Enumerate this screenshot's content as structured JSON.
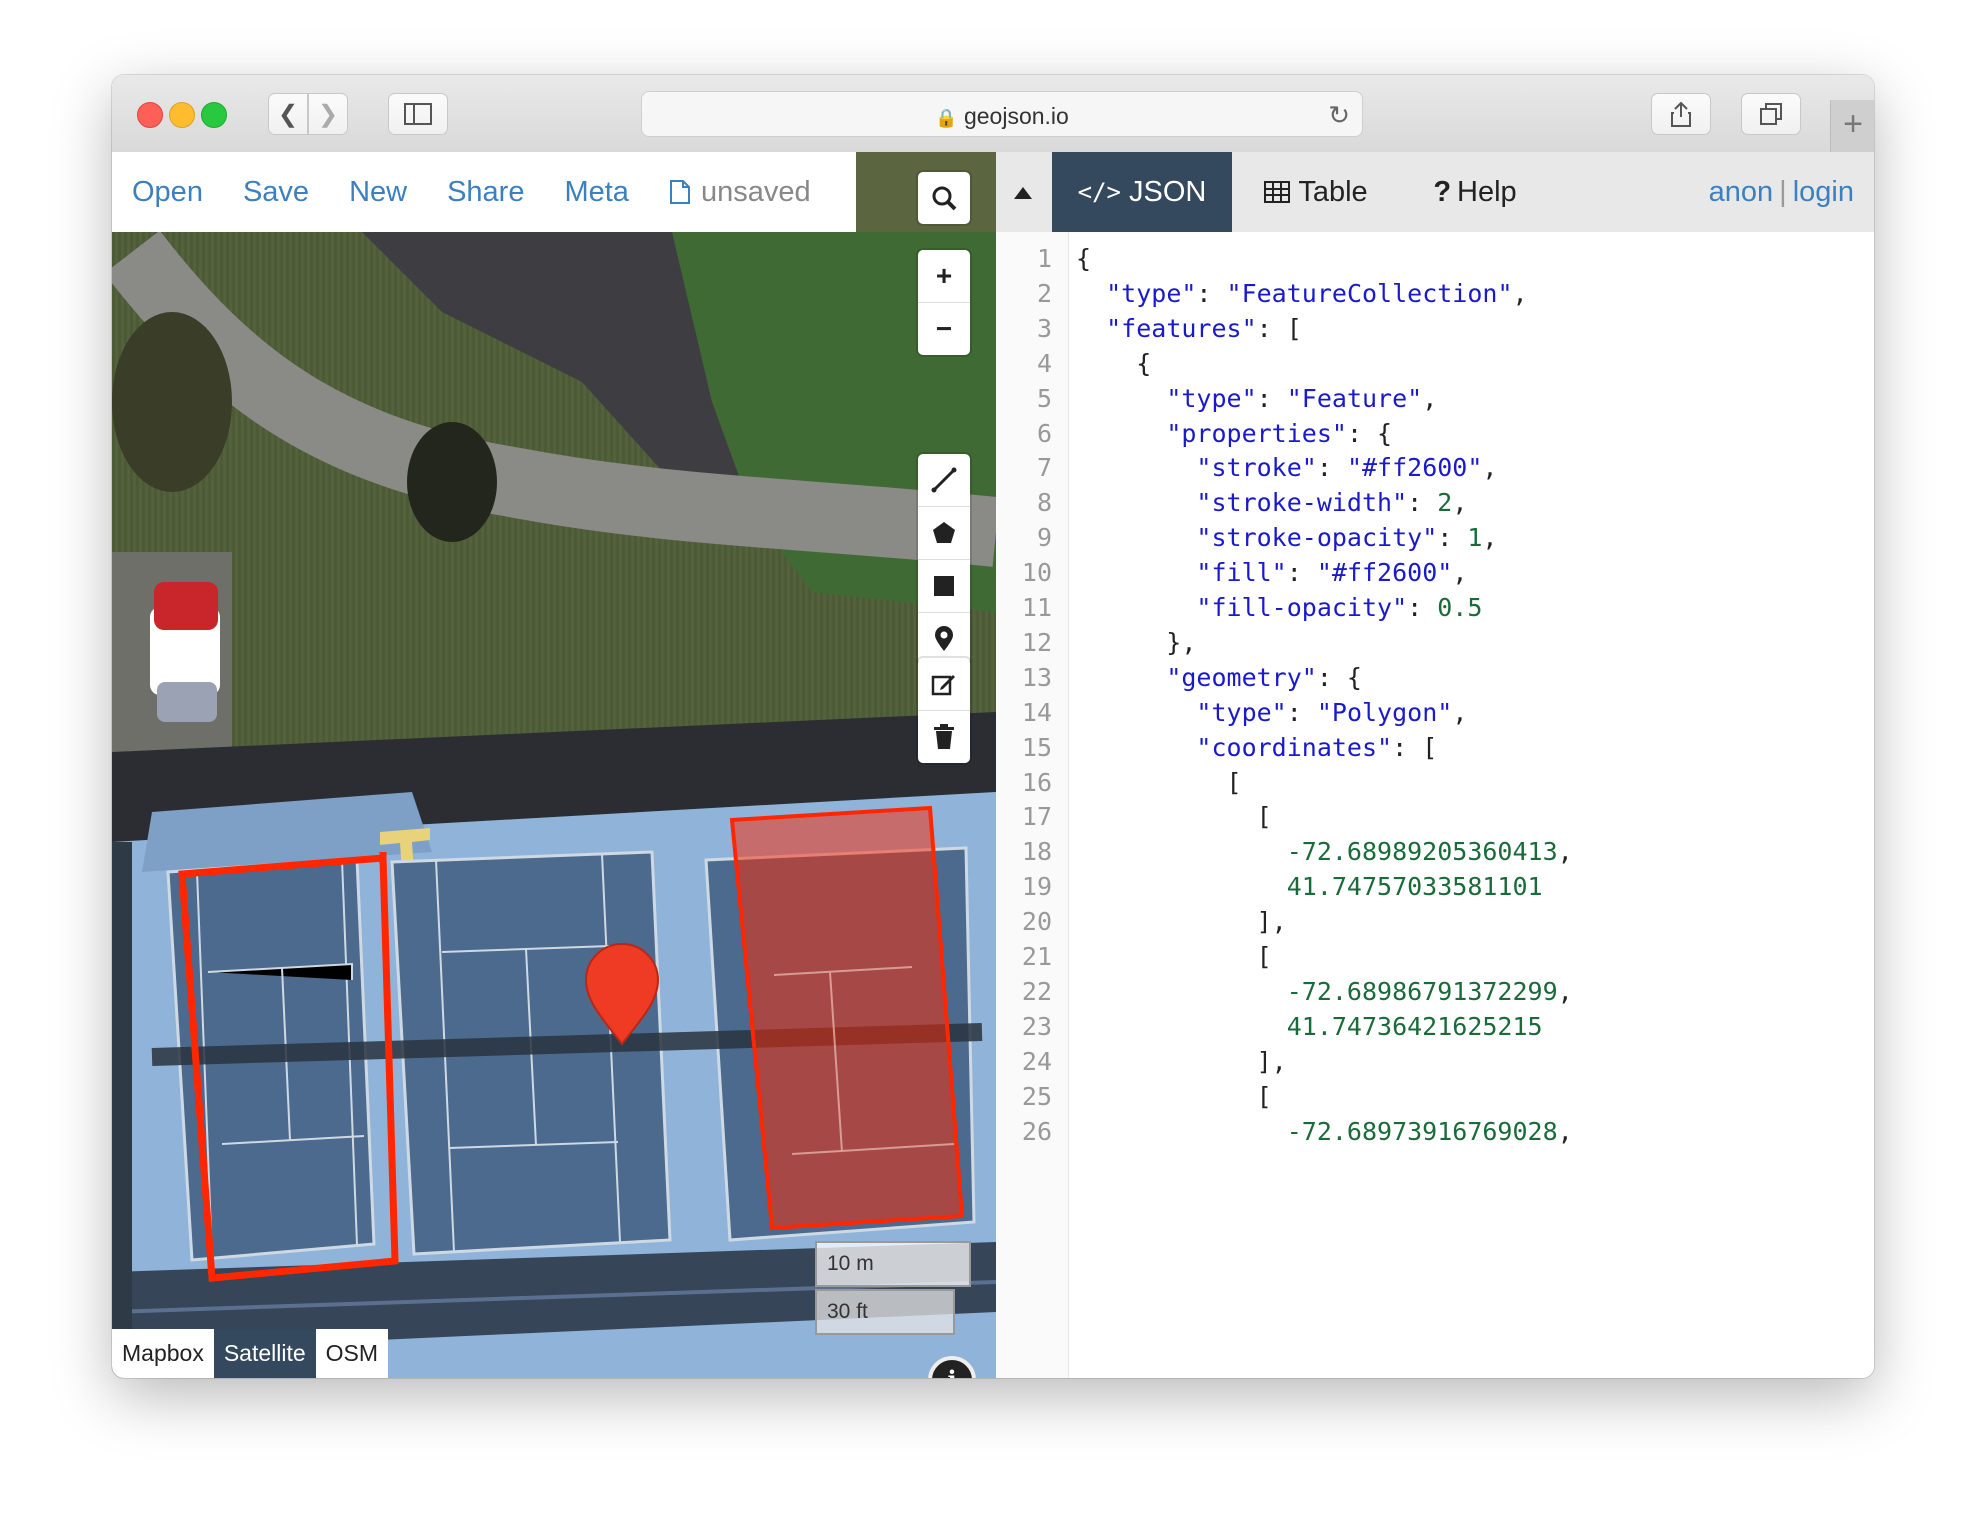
{
  "browser": {
    "url": "geojson.io"
  },
  "menu": {
    "open": "Open",
    "save": "Save",
    "new": "New",
    "share": "Share",
    "meta": "Meta",
    "status": "unsaved"
  },
  "map": {
    "scale_metric": "10 m",
    "scale_imperial": "30 ft",
    "layers": [
      "Mapbox",
      "Satellite",
      "OSM"
    ],
    "active_layer": "Satellite",
    "feature_color": "#ff2600"
  },
  "panel": {
    "tabs": [
      "JSON",
      "Table",
      "Help"
    ],
    "active_tab": "JSON",
    "user": "anon",
    "separator": "|",
    "login": "login"
  },
  "code_lines": [
    "{",
    "  \"type\": \"FeatureCollection\",",
    "  \"features\": [",
    "    {",
    "      \"type\": \"Feature\",",
    "      \"properties\": {",
    "        \"stroke\": \"#ff2600\",",
    "        \"stroke-width\": 2,",
    "        \"stroke-opacity\": 1,",
    "        \"fill\": \"#ff2600\",",
    "        \"fill-opacity\": 0.5",
    "      },",
    "      \"geometry\": {",
    "        \"type\": \"Polygon\",",
    "        \"coordinates\": [",
    "          [",
    "            [",
    "              -72.68989205360413,",
    "              41.74757033581101",
    "            ],",
    "            [",
    "              -72.68986791372299,",
    "              41.74736421625215",
    "            ],",
    "            [",
    "              -72.68973916769028,"
  ]
}
